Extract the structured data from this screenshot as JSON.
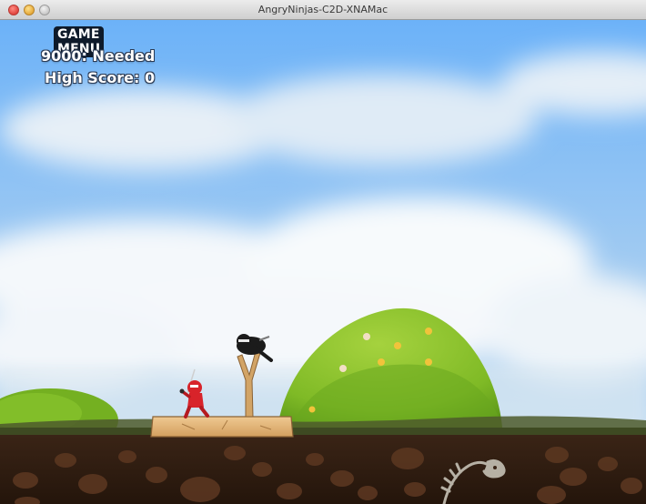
{
  "window": {
    "title": "AngryNinjas-C2D-XNAMac"
  },
  "hud": {
    "menu_label": "GAME MENU",
    "needed_score": "9000",
    "needed_label": ": Needed",
    "high_score_label": "High Score: ",
    "high_score_value": "0"
  },
  "colors": {
    "sky_top": "#74b6f7",
    "sky_bottom": "#cfe3f4",
    "hill_green": "#86c22c",
    "soil": "#2f1c10",
    "ninja_red": "#d8232a",
    "platform_wood": "#e2b77a"
  }
}
